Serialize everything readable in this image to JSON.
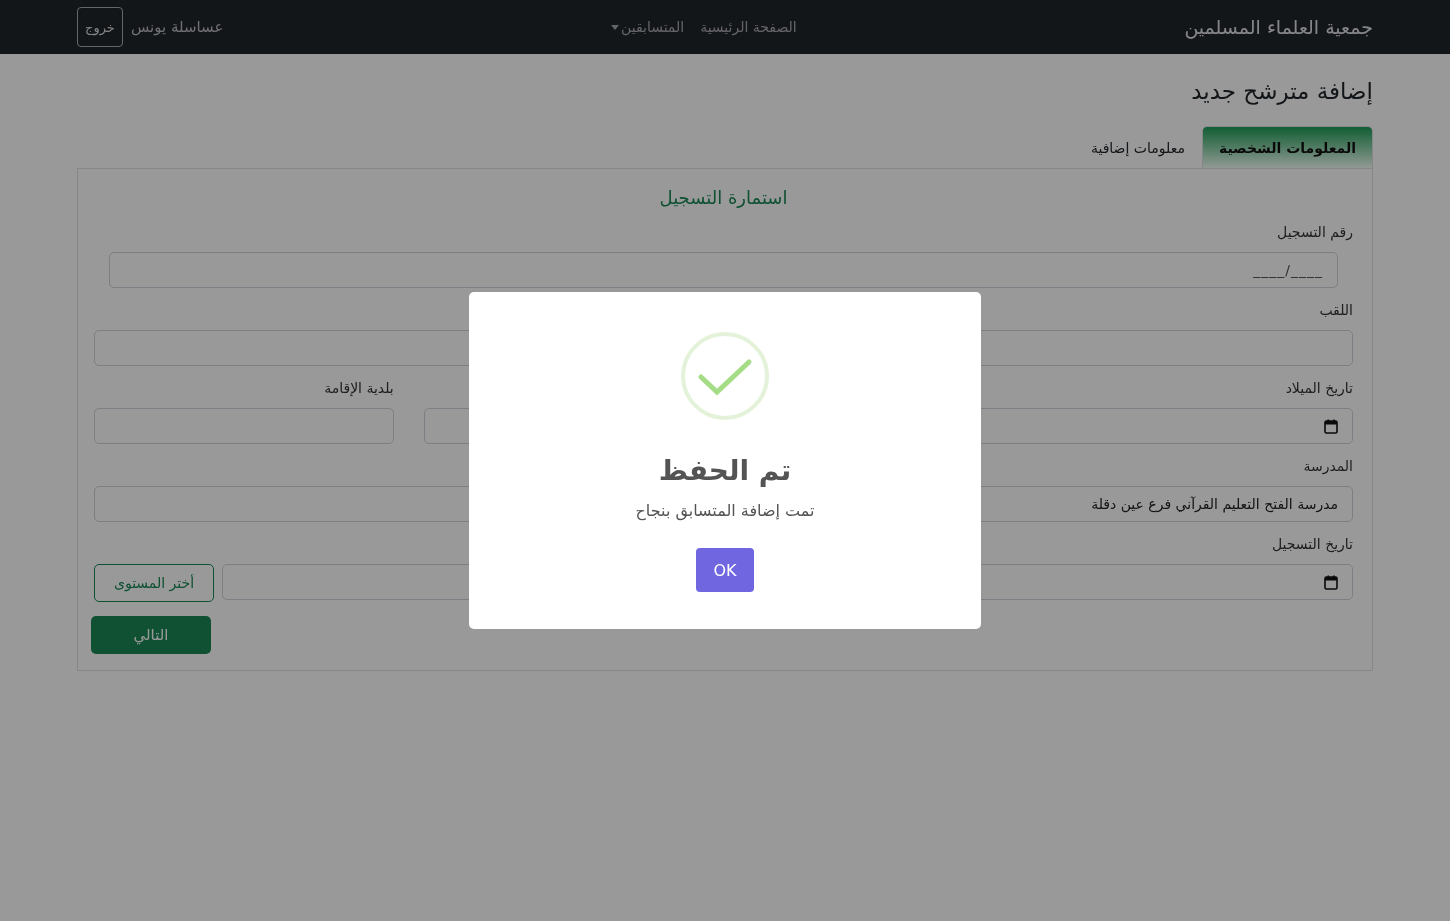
{
  "navbar": {
    "brand": "جمعية العلماء المسلمين",
    "links": [
      {
        "label": "الصفحة الرئيسية",
        "dropdown": false
      },
      {
        "label": "المتسابقين",
        "dropdown": true
      }
    ],
    "user": "عساسلة يونس",
    "logout": "خروج"
  },
  "page_title": "إضافة مترشح جديد",
  "tabs": [
    {
      "label": "المعلومات الشخصية",
      "selected": true
    },
    {
      "label": "معلومات إضافية",
      "selected": false
    }
  ],
  "form": {
    "title": "استمارة التسجيل",
    "rows": [
      [
        {
          "kind": "masked",
          "label": "رقم التسجيل",
          "placeholder": "____/____"
        }
      ],
      [
        {
          "kind": "text",
          "label": "اللقب"
        }
      ],
      [
        {
          "kind": "date",
          "label": "تاريخ الميلاد"
        },
        {
          "kind": "text"
        },
        {
          "kind": "text",
          "label": "بلدية الإقامة"
        }
      ],
      [
        {
          "kind": "text",
          "label": "المدرسة",
          "value": "مدرسة الفتح التعليم القرآني فرع عين دقلة"
        }
      ],
      [
        {
          "kind": "date",
          "label": "تاريخ التسجيل"
        },
        {
          "kind": "picker",
          "button": "أختر المستوى"
        }
      ]
    ],
    "next_button": "التالي"
  },
  "dialog": {
    "kind": "success",
    "title": "تم الحفظ",
    "message": "تمت إضافة المتسابق بنجاح",
    "button": "OK"
  }
}
